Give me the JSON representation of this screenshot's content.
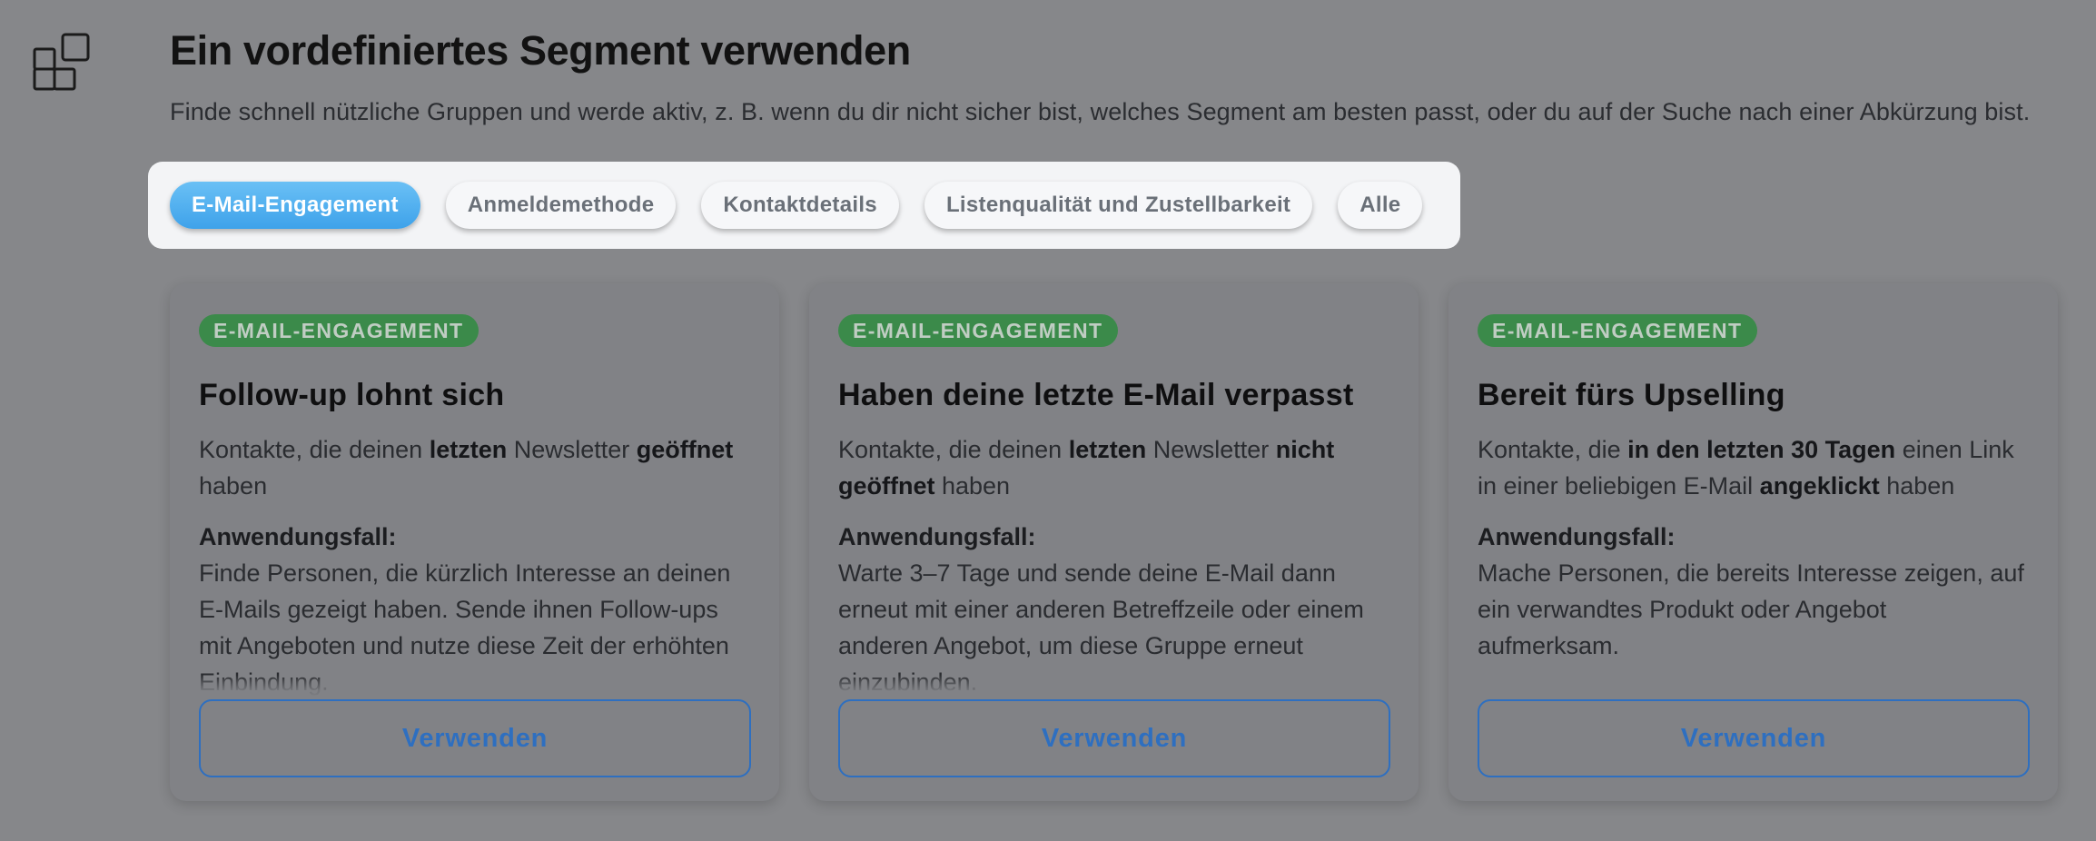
{
  "header": {
    "title": "Ein vordefiniertes Segment verwenden",
    "subtitle": "Finde schnell nützliche Gruppen und werde aktiv, z. B. wenn du dir nicht sicher bist, welches Segment am besten passt, oder du auf der Suche nach einer Abkürzung bist.",
    "icon": "segments-grid-icon"
  },
  "filters": [
    {
      "label": "E-Mail-Engagement",
      "active": true
    },
    {
      "label": "Anmeldemethode",
      "active": false
    },
    {
      "label": "Kontaktdetails",
      "active": false
    },
    {
      "label": "Listenqualität und Zustellbarkeit",
      "active": false
    },
    {
      "label": "Alle",
      "active": false
    }
  ],
  "cards": [
    {
      "badge": "E-MAIL-ENGAGEMENT",
      "title": "Follow-up lohnt sich",
      "desc": [
        {
          "t": "Kontakte, die deinen "
        },
        {
          "t": "letzten",
          "b": true
        },
        {
          "t": " Newsletter "
        },
        {
          "t": "geöffnet",
          "b": true
        },
        {
          "t": " haben"
        }
      ],
      "usecase_label": "Anwendungsfall:",
      "usecase_text": "Finde Personen, die kürzlich Interesse an deinen E-Mails gezeigt haben. Sende ihnen Follow-ups mit Angeboten und nutze diese Zeit der erhöhten Einbindung.",
      "button": "Verwenden"
    },
    {
      "badge": "E-MAIL-ENGAGEMENT",
      "title": "Haben deine letzte E-Mail verpasst",
      "desc": [
        {
          "t": "Kontakte, die deinen "
        },
        {
          "t": "letzten",
          "b": true
        },
        {
          "t": " Newsletter "
        },
        {
          "t": "nicht geöffnet",
          "b": true
        },
        {
          "t": " haben"
        }
      ],
      "usecase_label": "Anwendungsfall:",
      "usecase_text": "Warte 3–7 Tage und sende deine E-Mail dann erneut mit einer anderen Betreffzeile oder einem anderen Angebot, um diese Gruppe erneut einzubinden.",
      "button": "Verwenden"
    },
    {
      "badge": "E-MAIL-ENGAGEMENT",
      "title": "Bereit fürs Upselling",
      "desc": [
        {
          "t": "Kontakte, die "
        },
        {
          "t": "in den letzten 30 Tagen",
          "b": true
        },
        {
          "t": " einen Link in einer beliebigen E-Mail "
        },
        {
          "t": "angeklickt",
          "b": true
        },
        {
          "t": " haben"
        }
      ],
      "usecase_label": "Anwendungsfall:",
      "usecase_text": "Mache Personen, die bereits Interesse zeigen, auf ein verwandtes Produkt oder Angebot aufmerksam.",
      "button": "Verwenden"
    }
  ],
  "colors": {
    "overlay": "#86878a",
    "accent": "#3ea2ea",
    "badge": "#3b8a4a",
    "button": "#2e6fc0"
  }
}
